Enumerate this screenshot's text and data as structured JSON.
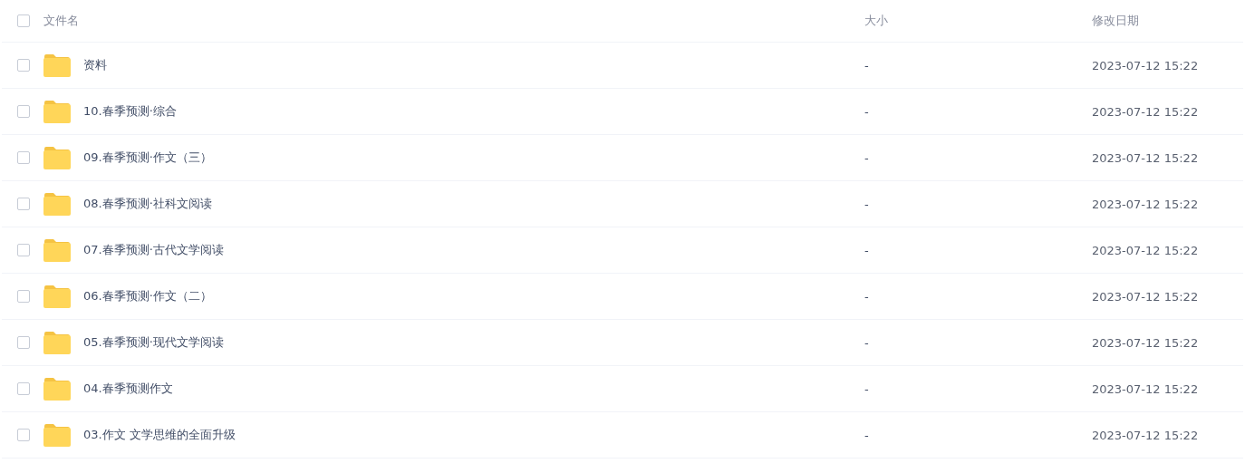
{
  "table": {
    "select_all": {
      "checked": false
    },
    "columns": [
      "文件名",
      "大小",
      "修改日期"
    ],
    "rows": [
      {
        "name": "资料",
        "size": "-",
        "modified": "2023-07-12 15:22",
        "checked": false
      },
      {
        "name": "10.春季预测·综合",
        "size": "-",
        "modified": "2023-07-12 15:22",
        "checked": false
      },
      {
        "name": "09.春季预测·作文（三）",
        "size": "-",
        "modified": "2023-07-12 15:22",
        "checked": false
      },
      {
        "name": "08.春季预测·社科文阅读",
        "size": "-",
        "modified": "2023-07-12 15:22",
        "checked": false
      },
      {
        "name": "07.春季预测·古代文学阅读",
        "size": "-",
        "modified": "2023-07-12 15:22",
        "checked": false
      },
      {
        "name": "06.春季预测·作文（二）",
        "size": "-",
        "modified": "2023-07-12 15:22",
        "checked": false
      },
      {
        "name": "05.春季预测·现代文学阅读",
        "size": "-",
        "modified": "2023-07-12 15:22",
        "checked": false
      },
      {
        "name": "04.春季预测作文",
        "size": "-",
        "modified": "2023-07-12 15:22",
        "checked": false
      },
      {
        "name": "03.作文 文学思维的全面升级",
        "size": "-",
        "modified": "2023-07-12 15:22",
        "checked": false
      }
    ]
  }
}
